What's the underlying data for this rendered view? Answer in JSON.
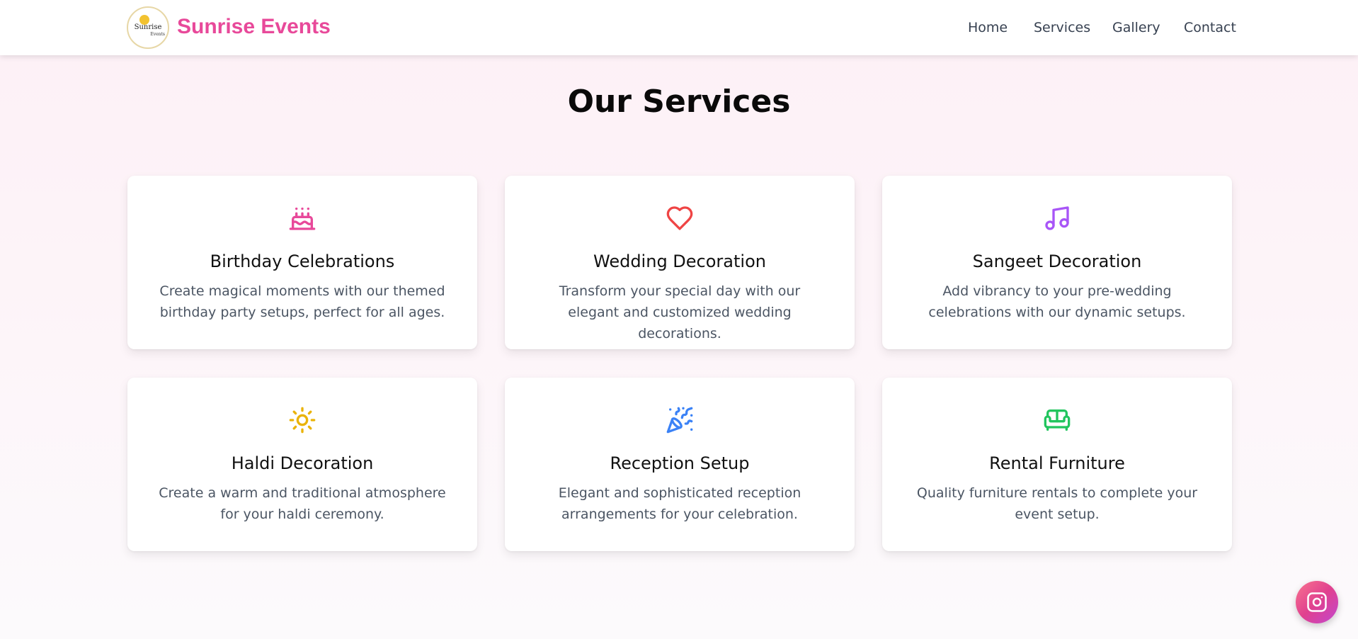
{
  "header": {
    "logo": {
      "line1": "Sunrise",
      "line2": "Events"
    },
    "brand": "Sunrise Events",
    "nav": [
      {
        "label": "Home"
      },
      {
        "label": "Services"
      },
      {
        "label": "Gallery"
      },
      {
        "label": "Contact"
      }
    ]
  },
  "services": {
    "title": "Our Services",
    "items": [
      {
        "icon": "birthday-cake-icon",
        "color": "#e8499a",
        "title": "Birthday Celebrations",
        "description": "Create magical moments with our themed birthday party setups, perfect for all ages."
      },
      {
        "icon": "heart-icon",
        "color": "#ef4444",
        "title": "Wedding Decoration",
        "description": "Transform your special day with our elegant and customized wedding decorations."
      },
      {
        "icon": "music-note-icon",
        "color": "#a855f7",
        "title": "Sangeet Decoration",
        "description": "Add vibrancy to your pre-wedding celebrations with our dynamic setups."
      },
      {
        "icon": "sun-icon",
        "color": "#eab308",
        "title": "Haldi Decoration",
        "description": "Create a warm and traditional atmosphere for your haldi ceremony."
      },
      {
        "icon": "party-popper-icon",
        "color": "#3b82f6",
        "title": "Reception Setup",
        "description": "Elegant and sophisticated reception arrangements for your celebration."
      },
      {
        "icon": "sofa-icon",
        "color": "#22c55e",
        "title": "Rental Furniture",
        "description": "Quality furniture rentals to complete your event setup."
      }
    ]
  },
  "floating": {
    "icon": "instagram-icon",
    "gradient": [
      "#f9738f",
      "#e0418f",
      "#c247cf"
    ]
  }
}
